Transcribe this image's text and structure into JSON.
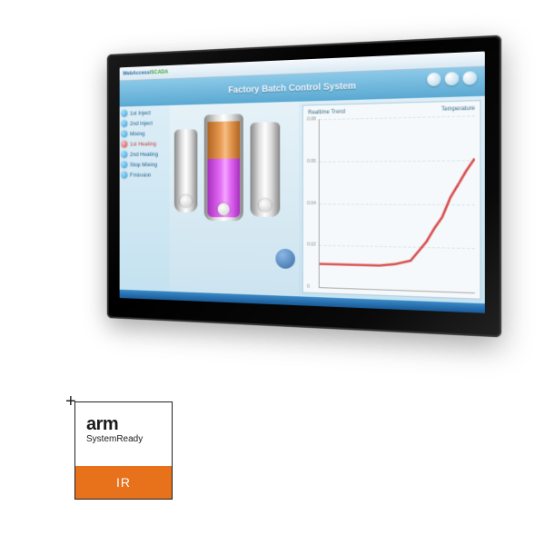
{
  "titlebar": {
    "app_label": "WebAccess/",
    "app_sub": "SCADA"
  },
  "banner": {
    "system_title": "Factory Batch Control System"
  },
  "sidebar": {
    "steps": [
      {
        "label": "1st Inject",
        "active": false
      },
      {
        "label": "2nd Inject",
        "active": false
      },
      {
        "label": "Mixing",
        "active": false
      },
      {
        "label": "1st Heating",
        "active": true
      },
      {
        "label": "2nd Heating",
        "active": false
      },
      {
        "label": "Stop Mixing",
        "active": false
      },
      {
        "label": "Emission",
        "active": false
      }
    ]
  },
  "chart": {
    "title": "Realtime Trend",
    "right_label": "Temperature"
  },
  "chart_data": {
    "type": "line",
    "title": "Realtime Trend",
    "xlabel": "",
    "ylabel": "Temperature",
    "ylim": [
      0,
      0.08
    ],
    "y_ticks": [
      0,
      0.02,
      0.04,
      0.06,
      0.08
    ],
    "series": [
      {
        "name": "Temperature",
        "color": "#d84a4a",
        "x": [
          0,
          0.1,
          0.2,
          0.3,
          0.4,
          0.5,
          0.6,
          0.7,
          0.75,
          0.8,
          0.85,
          0.9,
          0.95,
          1.0
        ],
        "values": [
          0.002,
          0.002,
          0.002,
          0.002,
          0.002,
          0.003,
          0.005,
          0.015,
          0.022,
          0.028,
          0.038,
          0.045,
          0.052,
          0.058
        ]
      }
    ]
  },
  "badge": {
    "brand": "arm",
    "program": "SystemReady",
    "tier": "IR"
  }
}
